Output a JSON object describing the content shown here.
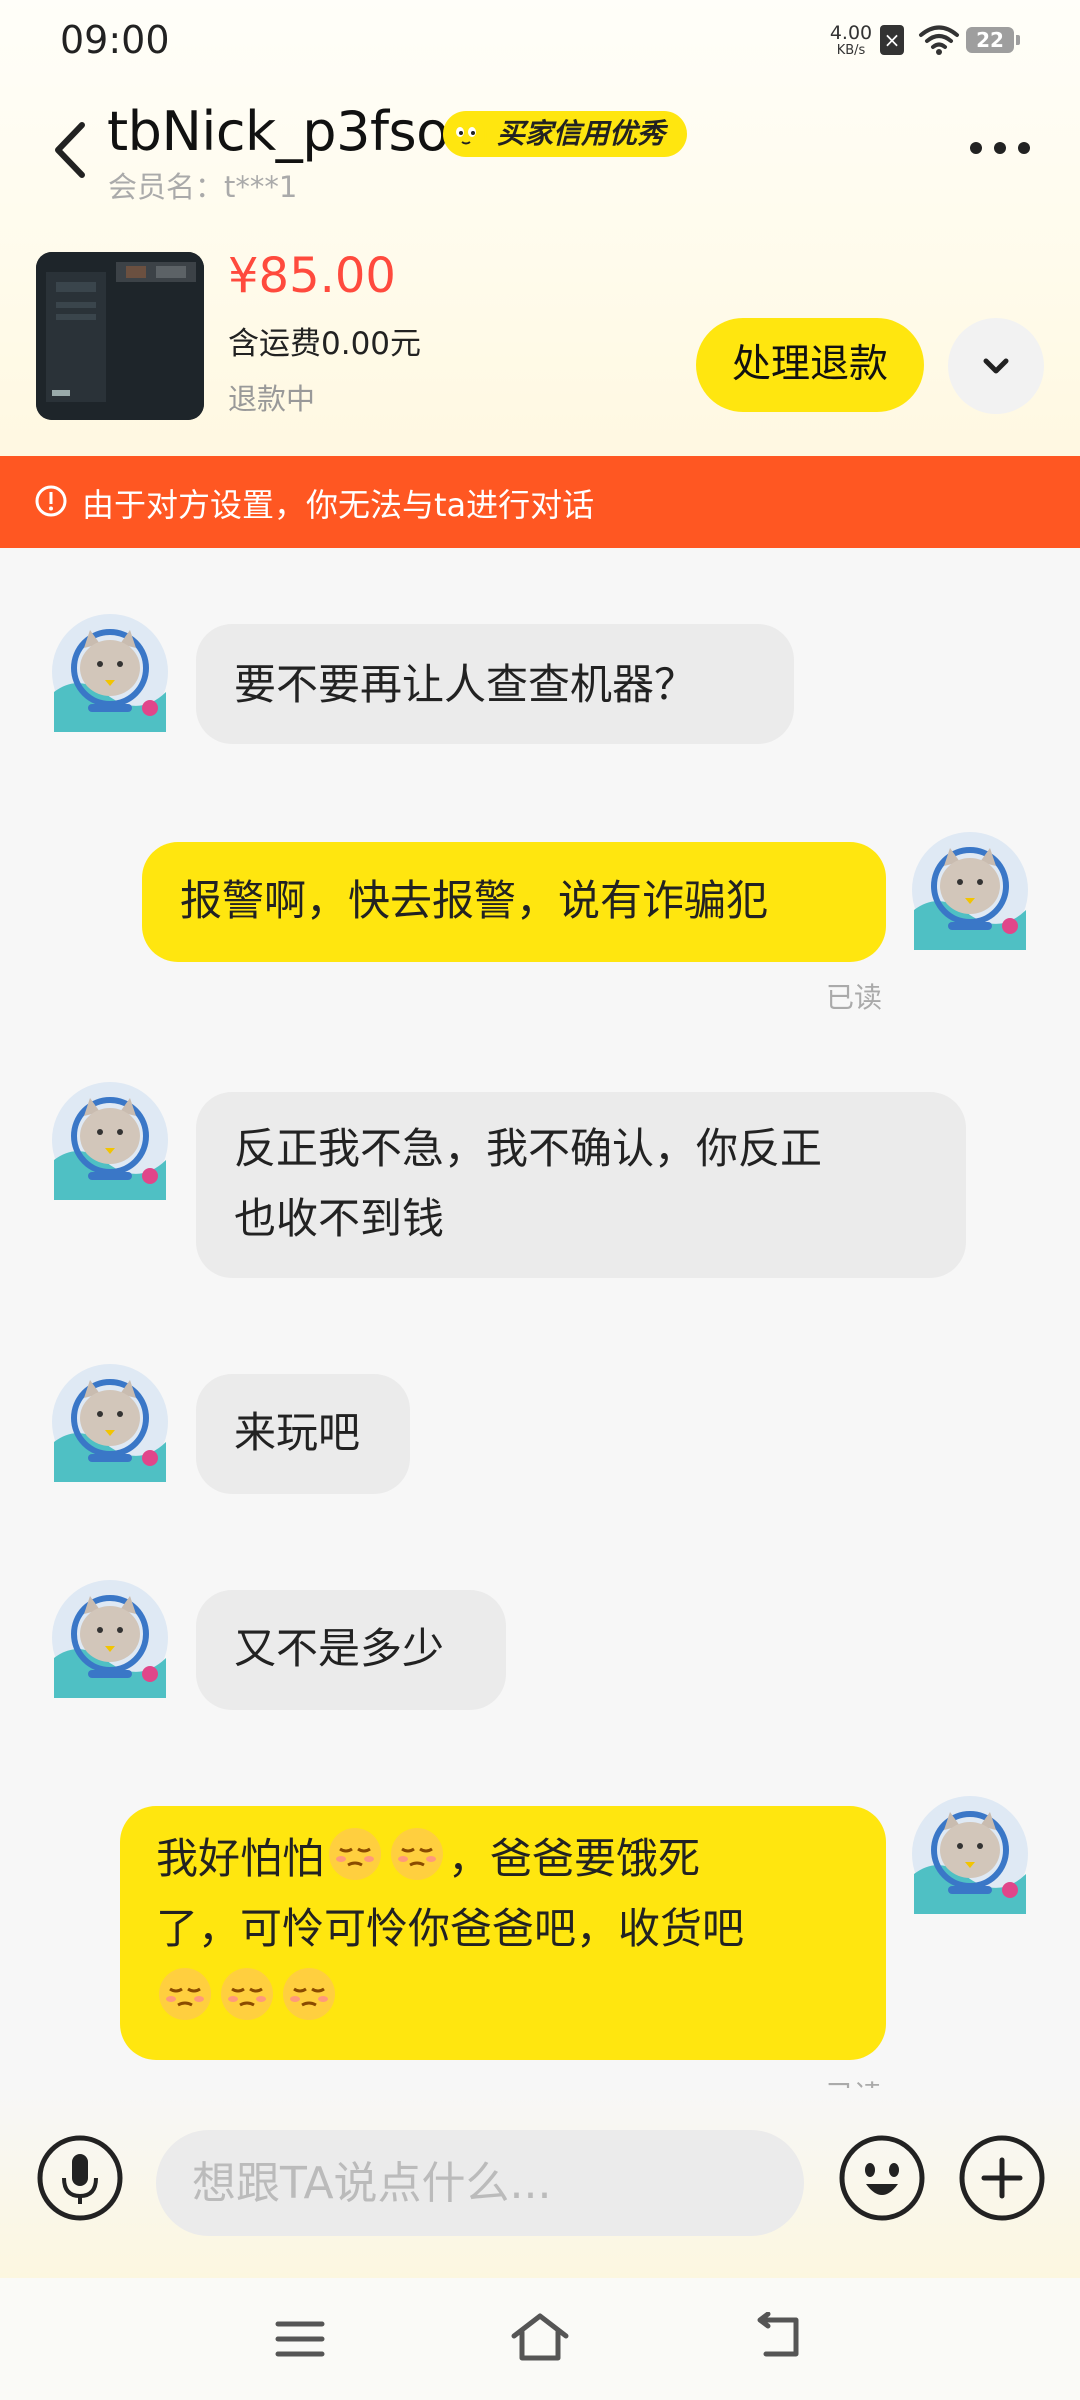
{
  "status_bar": {
    "time": "09:00",
    "net_speed_value": "4.00",
    "net_speed_unit": "KB/s",
    "battery": "22"
  },
  "header": {
    "title": "tbNick_p3fso",
    "badge": "买家信用优秀",
    "member": "会员名：t***1"
  },
  "order": {
    "price": "¥85.00",
    "shipping": "含运费0.00元",
    "status": "退款中",
    "action_label": "处理退款"
  },
  "banner": {
    "text": "由于对方设置，你无法与ta进行对话"
  },
  "messages": [
    {
      "side": "in",
      "text": "要不要再让人查查机器？"
    },
    {
      "side": "out",
      "text": "报警啊，快去报警，说有诈骗犯",
      "read": "已读"
    },
    {
      "side": "in",
      "line1": "反正我不急，我不确认，你反正",
      "line2": "也收不到钱"
    },
    {
      "side": "in",
      "text": "来玩吧"
    },
    {
      "side": "in",
      "text": "又不是多少"
    },
    {
      "side": "out",
      "line1a": "我好怕怕",
      "line1b": "，爸爸要饿死",
      "line2": "了，可怜可怜你爸爸吧，收货吧",
      "read": "已读",
      "emoji_count_line1": 2,
      "emoji_count_line3": 3
    }
  ],
  "input": {
    "placeholder": "想跟TA说点什么..."
  },
  "colors": {
    "accent_yellow": "#ffe60f",
    "banner_orange": "#ff5722",
    "price_red": "#ff4a3d",
    "incoming_bubble": "#ebebeb"
  },
  "icons": [
    "back-icon",
    "more-icon",
    "chevron-down-icon",
    "warning-icon",
    "microphone-icon",
    "smiley-icon",
    "plus-icon",
    "menu-icon",
    "home-icon",
    "back-nav-icon"
  ]
}
